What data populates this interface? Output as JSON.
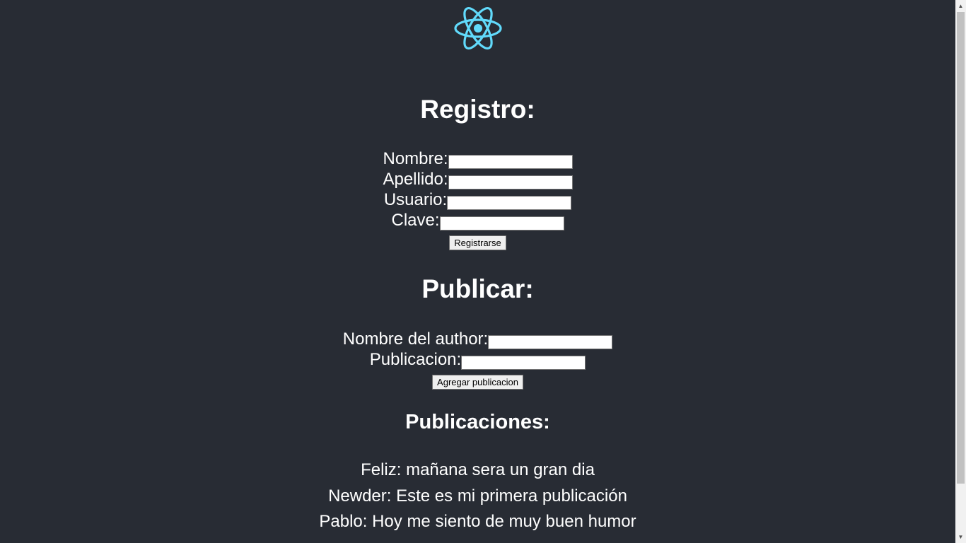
{
  "registro": {
    "title": "Registro:",
    "fields": [
      {
        "label": "Nombre:",
        "value": ""
      },
      {
        "label": "Apellido:",
        "value": ""
      },
      {
        "label": "Usuario:",
        "value": ""
      },
      {
        "label": "Clave:",
        "value": ""
      }
    ],
    "button": "Registrarse"
  },
  "publicar": {
    "title": "Publicar:",
    "fields": [
      {
        "label": "Nombre del author:",
        "value": ""
      },
      {
        "label": "Publicacion:",
        "value": ""
      }
    ],
    "button": "Agregar publicacion"
  },
  "publicaciones": {
    "title": "Publicaciones:",
    "items": [
      {
        "author": "Feliz:",
        "text": "mañana sera un gran dia"
      },
      {
        "author": "Newder:",
        "text": "Este es mi primera publicación"
      },
      {
        "author": "Pablo:",
        "text": "Hoy me siento de muy buen humor"
      }
    ]
  },
  "colors": {
    "background": "#282c34",
    "logo": "#61dafb"
  },
  "icons": {
    "logo": "react-logo-icon",
    "scroll_up": "arrow-up-icon",
    "scroll_down": "arrow-down-icon"
  }
}
